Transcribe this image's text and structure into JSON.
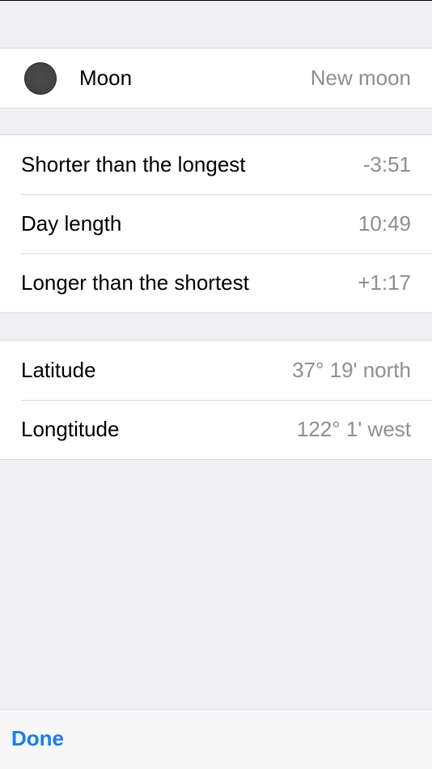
{
  "moon": {
    "label": "Moon",
    "value": "New moon",
    "icon": "moon-phase-icon"
  },
  "daylight": {
    "rows": [
      {
        "label": "Shorter than the longest",
        "value": "-3:51"
      },
      {
        "label": "Day length",
        "value": "10:49"
      },
      {
        "label": "Longer than the shortest",
        "value": "+1:17"
      }
    ]
  },
  "location": {
    "rows": [
      {
        "label": "Latitude",
        "value": "37° 19' north"
      },
      {
        "label": "Longtitude",
        "value": "122° 1' west"
      }
    ]
  },
  "toolbar": {
    "done_label": "Done"
  },
  "colors": {
    "background": "#efeff4",
    "accent": "#1a7ee8",
    "secondary_text": "#8e8e93"
  }
}
